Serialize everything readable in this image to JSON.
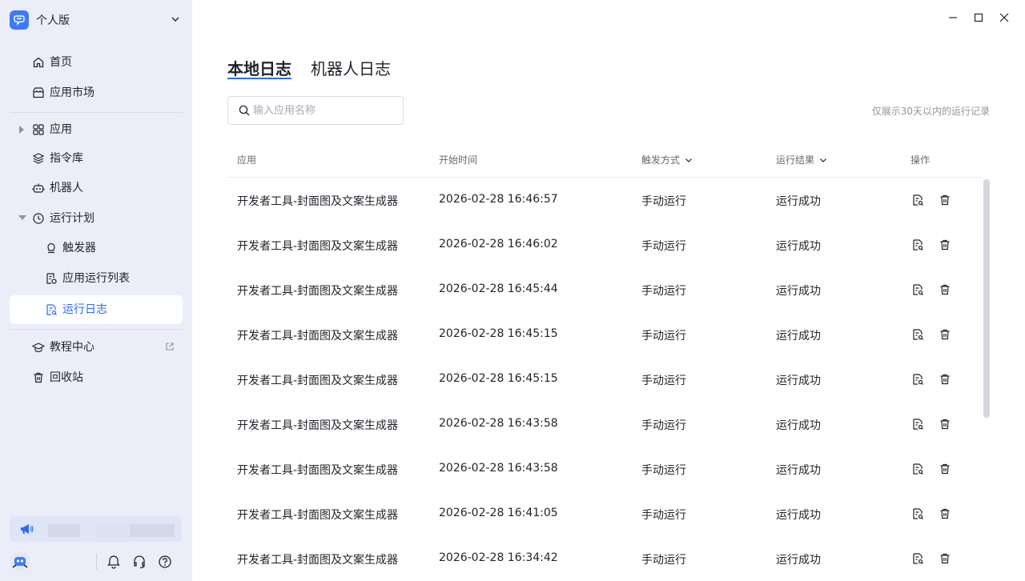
{
  "workspace": {
    "name": "个人版"
  },
  "nav": {
    "home": "首页",
    "market": "应用市场",
    "apps": "应用",
    "commands": "指令库",
    "robot": "机器人",
    "schedule": "运行计划",
    "trigger": "触发器",
    "app_run_list": "应用运行列表",
    "run_log": "运行日志",
    "tutorial": "教程中心",
    "recycle": "回收站"
  },
  "tabs": {
    "local": "本地日志",
    "robot": "机器人日志"
  },
  "search": {
    "placeholder": "输入应用名称"
  },
  "hint": "仅展示30天以内的运行记录",
  "table": {
    "headers": {
      "app": "应用",
      "start_time": "开始时间",
      "trigger": "触发方式",
      "result": "运行结果",
      "action": "操作"
    },
    "rows": [
      {
        "app": "开发者工具-封面图及文案生成器",
        "time": "2026-02-28 16:46:57",
        "trigger": "手动运行",
        "result": "运行成功"
      },
      {
        "app": "开发者工具-封面图及文案生成器",
        "time": "2026-02-28 16:46:02",
        "trigger": "手动运行",
        "result": "运行成功"
      },
      {
        "app": "开发者工具-封面图及文案生成器",
        "time": "2026-02-28 16:45:44",
        "trigger": "手动运行",
        "result": "运行成功"
      },
      {
        "app": "开发者工具-封面图及文案生成器",
        "time": "2026-02-28 16:45:15",
        "trigger": "手动运行",
        "result": "运行成功"
      },
      {
        "app": "开发者工具-封面图及文案生成器",
        "time": "2026-02-28 16:45:15",
        "trigger": "手动运行",
        "result": "运行成功"
      },
      {
        "app": "开发者工具-封面图及文案生成器",
        "time": "2026-02-28 16:43:58",
        "trigger": "手动运行",
        "result": "运行成功"
      },
      {
        "app": "开发者工具-封面图及文案生成器",
        "time": "2026-02-28 16:43:58",
        "trigger": "手动运行",
        "result": "运行成功"
      },
      {
        "app": "开发者工具-封面图及文案生成器",
        "time": "2026-02-28 16:41:05",
        "trigger": "手动运行",
        "result": "运行成功"
      },
      {
        "app": "开发者工具-封面图及文案生成器",
        "time": "2026-02-28 16:34:42",
        "trigger": "手动运行",
        "result": "运行成功"
      }
    ]
  },
  "icons": {
    "workspace_logo": "robot-logo-icon",
    "view_log": "log-view-icon",
    "delete": "trash-icon",
    "notice": "megaphone-icon",
    "bell": "bell-icon",
    "support": "headset-icon",
    "help": "help-icon"
  },
  "colors": {
    "accent": "#2f6bed",
    "sidebar_bg": "#ebeef9",
    "logo_bg": "#3d7bf7"
  }
}
